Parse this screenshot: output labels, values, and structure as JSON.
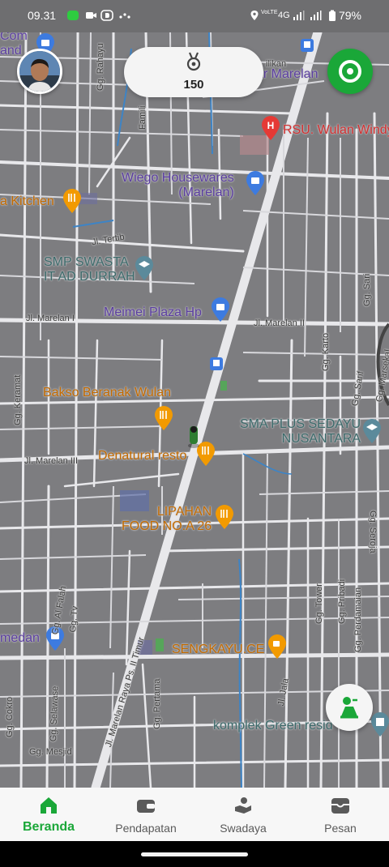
{
  "status_bar": {
    "time": "09.31",
    "network": "4G",
    "network_sub": "VoLTE",
    "battery": "79%"
  },
  "map": {
    "pois": [
      {
        "name": "RSU. Wulan Windy",
        "type": "hospital"
      },
      {
        "name": "Wiego Housewares\n(Marelan)",
        "type": "shop"
      },
      {
        "name": "SMP SWASTA\nIT AD DURRAH",
        "type": "edu"
      },
      {
        "name": "Meimei Plaza Hp",
        "type": "shop"
      },
      {
        "name": "Bakso Beranak Wulan",
        "type": "food"
      },
      {
        "name": "SMA PLUS SEDAYU\nNUSANTARA",
        "type": "edu"
      },
      {
        "name": "Denatural resto",
        "type": "food"
      },
      {
        "name": "LIPAHAN\nFOOD NO.A 26",
        "type": "food"
      },
      {
        "name": "SENGKAYU.CE",
        "type": "food"
      },
      {
        "name": "komplek Green resid",
        "type": "edu"
      },
      {
        "name": "a Kitchen",
        "type": "food"
      },
      {
        "name": "medan",
        "type": "shop"
      },
      {
        "name": "Com\nand",
        "type": "shop"
      },
      {
        "name": "ar Marelan",
        "type": "shop"
      },
      {
        "name": "ilikan",
        "type": "shop"
      }
    ],
    "streets": [
      "Gg. Rahayu",
      "Famili",
      "Jl. Tertib",
      "Jl. Marelan I",
      "Jl. Marelan II",
      "Jl. Marelan III",
      "Gg. Keramat",
      "Gg. Karto",
      "Gg. Sari",
      "Gg. Sarif",
      "Gg. Marsekal",
      "Gg. Seroja",
      "Gg. Al Falah",
      "Gg. Tv",
      "Gg. Selawase",
      "Gg. Cokro",
      "Gg. Mesjid",
      "Jl. Marelan Raya Ps. II Timur",
      "Gg. Pertama",
      "Gg. Tower",
      "Gg. Pribadi",
      "Gg. Perdamaian",
      "Jl. Jala"
    ]
  },
  "points": {
    "value": "150"
  },
  "nav": {
    "items": [
      {
        "label": "Beranda",
        "icon": "home-icon",
        "active": true
      },
      {
        "label": "Pendapatan",
        "icon": "wallet-icon",
        "active": false
      },
      {
        "label": "Swadaya",
        "icon": "helping-hand-icon",
        "active": false
      },
      {
        "label": "Pesan",
        "icon": "inbox-icon",
        "active": false
      }
    ]
  },
  "colors": {
    "accent": "#1aa738",
    "map_bg": "#7d7d80",
    "road": "#e9e9ec",
    "poi_food": "#f29a00",
    "poi_shop": "#3d7be0",
    "poi_hospital": "#e53935",
    "poi_edu": "#5b8a9b"
  }
}
